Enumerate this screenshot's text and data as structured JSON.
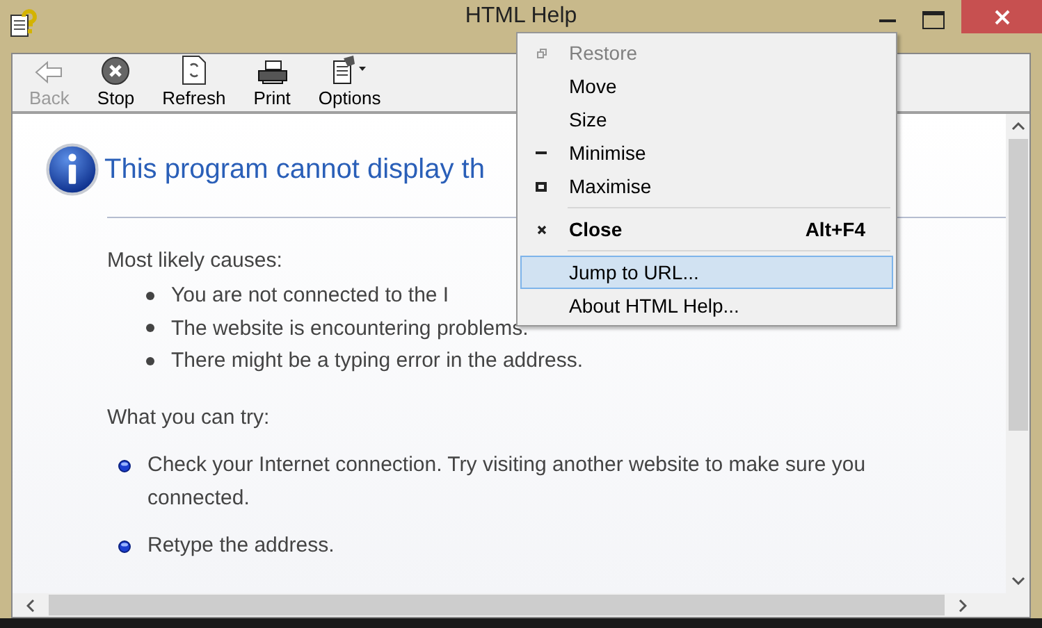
{
  "window": {
    "title": "HTML Help"
  },
  "toolbar": [
    {
      "label": "Back",
      "kind": "back",
      "disabled": true
    },
    {
      "label": "Stop",
      "kind": "stop",
      "disabled": false
    },
    {
      "label": "Refresh",
      "kind": "refresh",
      "disabled": false
    },
    {
      "label": "Print",
      "kind": "print",
      "disabled": false
    },
    {
      "label": "Options",
      "kind": "options",
      "disabled": false
    }
  ],
  "page": {
    "heading": "This program cannot display th",
    "causes_title": "Most likely causes:",
    "causes": [
      "You are not connected to the I",
      "The website is encountering problems.",
      "There might be a typing error in the address."
    ],
    "try_title": "What you can try:",
    "tries": [
      "Check your Internet connection. Try visiting another website to make sure you connected.",
      "Retype the address."
    ]
  },
  "system_menu": [
    {
      "label": "Restore",
      "kind": "restore",
      "disabled": true,
      "selected": false
    },
    {
      "label": "Move",
      "kind": "plain",
      "disabled": false,
      "selected": false
    },
    {
      "label": "Size",
      "kind": "plain",
      "disabled": false,
      "selected": false
    },
    {
      "label": "Minimise",
      "kind": "minimise",
      "disabled": false,
      "selected": false
    },
    {
      "label": "Maximise",
      "kind": "maximise",
      "disabled": false,
      "selected": false
    },
    {
      "kind": "separator"
    },
    {
      "label": "Close",
      "kind": "close",
      "shortcut": "Alt+F4",
      "disabled": false,
      "selected": false
    },
    {
      "kind": "separator"
    },
    {
      "label": "Jump to URL...",
      "kind": "plain",
      "disabled": false,
      "selected": true
    },
    {
      "label": "About HTML Help...",
      "kind": "plain",
      "disabled": false,
      "selected": false
    }
  ]
}
